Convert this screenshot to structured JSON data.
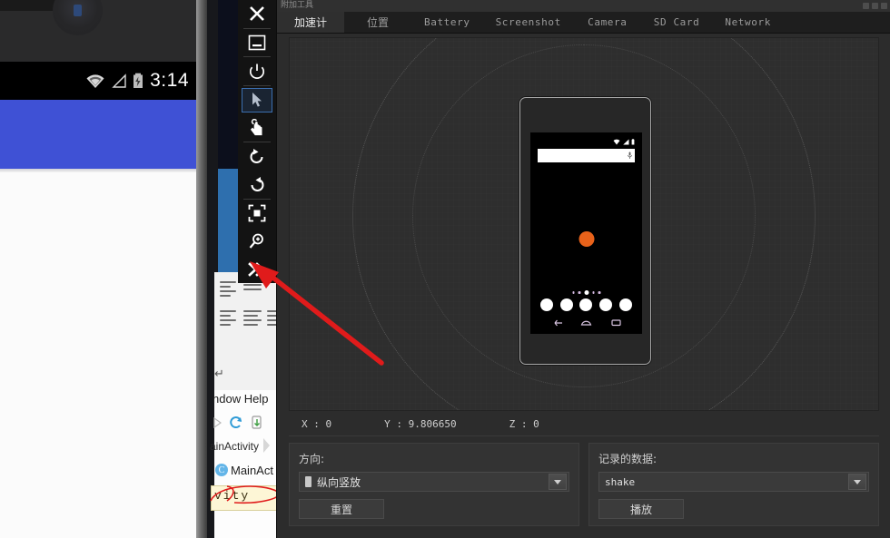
{
  "window": {
    "title": "附加工具",
    "controls": [
      "minimize",
      "maximize",
      "close"
    ]
  },
  "tabs": [
    {
      "label": "加速计",
      "active": true,
      "mono": false
    },
    {
      "label": "位置",
      "active": false,
      "mono": false
    },
    {
      "label": "Battery",
      "active": false,
      "mono": true
    },
    {
      "label": "Screenshot",
      "active": false,
      "mono": true
    },
    {
      "label": "Camera",
      "active": false,
      "mono": true
    },
    {
      "label": "SD Card",
      "active": false,
      "mono": true
    },
    {
      "label": "Network",
      "active": false,
      "mono": true
    }
  ],
  "readout": {
    "x": "X : 0",
    "y": "Y : 9.806650",
    "z": "Z : 0"
  },
  "panels": {
    "orientation": {
      "label": "方向:",
      "selected": "纵向竖放",
      "button": "重置"
    },
    "recorded": {
      "label": "记录的数据:",
      "selected": "shake",
      "button": "播放"
    }
  },
  "toolbar": {
    "items": [
      {
        "name": "close-icon",
        "title": "关闭"
      },
      {
        "name": "minimize-icon",
        "title": "最小化"
      },
      {
        "name": "power-icon",
        "title": "电源"
      },
      {
        "name": "pointer-icon",
        "title": "指针",
        "selected": true
      },
      {
        "name": "touch-hand-icon",
        "title": "触摸"
      },
      {
        "name": "rotate-left-icon",
        "title": "向左旋转"
      },
      {
        "name": "rotate-right-icon",
        "title": "向右旋转"
      },
      {
        "name": "screenshot-icon",
        "title": "屏幕截图"
      },
      {
        "name": "zoom-in-icon",
        "title": "放大"
      },
      {
        "name": "more-chevrons-icon",
        "title": "更多"
      }
    ]
  },
  "device_preview": {
    "home_color": "#8327a8",
    "accent_dot_color": "#e8621a",
    "page_dots": 5,
    "page_active_index": 2,
    "dock_icons": 5
  },
  "background_emulator": {
    "status_time": "3:14",
    "appbar_color": "#3f51d5"
  },
  "background_ide": {
    "menu": "ndow  Help",
    "breadcrumb": "ainActivity",
    "class_item": "MainAct",
    "class_badge": "C",
    "code_fragment": "vity"
  },
  "annotation": {
    "arrow_color": "#e01b1b",
    "points_to": "more-chevrons-icon"
  }
}
